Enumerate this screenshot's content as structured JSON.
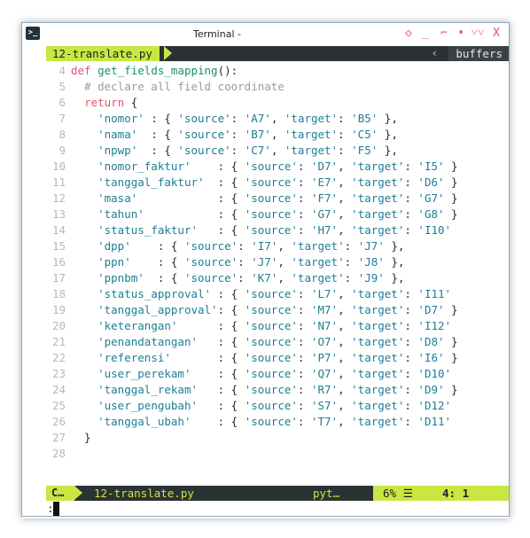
{
  "window": {
    "title": "Terminal -"
  },
  "controls": [
    "◇",
    "_",
    "⌐",
    "•",
    "˅˅",
    "X"
  ],
  "tabline": {
    "tab": "12-translate.py",
    "buffers": "buffers",
    "arrow": "‹"
  },
  "lines": [
    {
      "n": "4",
      "tokens": [
        [
          "kw",
          "def"
        ],
        [
          "pl",
          " "
        ],
        [
          "fn",
          "get_fields_mapping"
        ],
        [
          "pl",
          "():"
        ]
      ]
    },
    {
      "n": "5",
      "tokens": [
        [
          "cm",
          "  # declare all field coordinate"
        ]
      ]
    },
    {
      "n": "6",
      "tokens": [
        [
          "pl",
          "  "
        ],
        [
          "kw",
          "return"
        ],
        [
          "pl",
          " {"
        ]
      ]
    },
    {
      "n": "7",
      "tokens": [
        [
          "pl",
          "    "
        ],
        [
          "st",
          "'nomor'"
        ],
        [
          "pl",
          " : { "
        ],
        [
          "st",
          "'source'"
        ],
        [
          "pl",
          ": "
        ],
        [
          "st",
          "'A7'"
        ],
        [
          "pl",
          ", "
        ],
        [
          "st",
          "'target'"
        ],
        [
          "pl",
          ": "
        ],
        [
          "st",
          "'B5'"
        ],
        [
          "pl",
          " },"
        ]
      ]
    },
    {
      "n": "8",
      "tokens": [
        [
          "pl",
          "    "
        ],
        [
          "st",
          "'nama'"
        ],
        [
          "pl",
          "  : { "
        ],
        [
          "st",
          "'source'"
        ],
        [
          "pl",
          ": "
        ],
        [
          "st",
          "'B7'"
        ],
        [
          "pl",
          ", "
        ],
        [
          "st",
          "'target'"
        ],
        [
          "pl",
          ": "
        ],
        [
          "st",
          "'C5'"
        ],
        [
          "pl",
          " },"
        ]
      ]
    },
    {
      "n": "9",
      "tokens": [
        [
          "pl",
          "    "
        ],
        [
          "st",
          "'npwp'"
        ],
        [
          "pl",
          "  : { "
        ],
        [
          "st",
          "'source'"
        ],
        [
          "pl",
          ": "
        ],
        [
          "st",
          "'C7'"
        ],
        [
          "pl",
          ", "
        ],
        [
          "st",
          "'target'"
        ],
        [
          "pl",
          ": "
        ],
        [
          "st",
          "'F5'"
        ],
        [
          "pl",
          " },"
        ]
      ]
    },
    {
      "n": "10",
      "tokens": [
        [
          "pl",
          "    "
        ],
        [
          "st",
          "'nomor_faktur'"
        ],
        [
          "pl",
          "    : { "
        ],
        [
          "st",
          "'source'"
        ],
        [
          "pl",
          ": "
        ],
        [
          "st",
          "'D7'"
        ],
        [
          "pl",
          ", "
        ],
        [
          "st",
          "'target'"
        ],
        [
          "pl",
          ": "
        ],
        [
          "st",
          "'I5'"
        ],
        [
          "pl",
          " }"
        ]
      ]
    },
    {
      "n": "11",
      "tokens": [
        [
          "pl",
          "    "
        ],
        [
          "st",
          "'tanggal_faktur'"
        ],
        [
          "pl",
          "  : { "
        ],
        [
          "st",
          "'source'"
        ],
        [
          "pl",
          ": "
        ],
        [
          "st",
          "'E7'"
        ],
        [
          "pl",
          ", "
        ],
        [
          "st",
          "'target'"
        ],
        [
          "pl",
          ": "
        ],
        [
          "st",
          "'D6'"
        ],
        [
          "pl",
          " }"
        ]
      ]
    },
    {
      "n": "12",
      "tokens": [
        [
          "pl",
          "    "
        ],
        [
          "st",
          "'masa'"
        ],
        [
          "pl",
          "            : { "
        ],
        [
          "st",
          "'source'"
        ],
        [
          "pl",
          ": "
        ],
        [
          "st",
          "'F7'"
        ],
        [
          "pl",
          ", "
        ],
        [
          "st",
          "'target'"
        ],
        [
          "pl",
          ": "
        ],
        [
          "st",
          "'G7'"
        ],
        [
          "pl",
          " }"
        ]
      ]
    },
    {
      "n": "13",
      "tokens": [
        [
          "pl",
          "    "
        ],
        [
          "st",
          "'tahun'"
        ],
        [
          "pl",
          "           : { "
        ],
        [
          "st",
          "'source'"
        ],
        [
          "pl",
          ": "
        ],
        [
          "st",
          "'G7'"
        ],
        [
          "pl",
          ", "
        ],
        [
          "st",
          "'target'"
        ],
        [
          "pl",
          ": "
        ],
        [
          "st",
          "'G8'"
        ],
        [
          "pl",
          " }"
        ]
      ]
    },
    {
      "n": "14",
      "tokens": [
        [
          "pl",
          "    "
        ],
        [
          "st",
          "'status_faktur'"
        ],
        [
          "pl",
          "   : { "
        ],
        [
          "st",
          "'source'"
        ],
        [
          "pl",
          ": "
        ],
        [
          "st",
          "'H7'"
        ],
        [
          "pl",
          ", "
        ],
        [
          "st",
          "'target'"
        ],
        [
          "pl",
          ": "
        ],
        [
          "st",
          "'I10'"
        ]
      ]
    },
    {
      "n": "15",
      "tokens": [
        [
          "pl",
          "    "
        ],
        [
          "st",
          "'dpp'"
        ],
        [
          "pl",
          "    : { "
        ],
        [
          "st",
          "'source'"
        ],
        [
          "pl",
          ": "
        ],
        [
          "st",
          "'I7'"
        ],
        [
          "pl",
          ", "
        ],
        [
          "st",
          "'target'"
        ],
        [
          "pl",
          ": "
        ],
        [
          "st",
          "'J7'"
        ],
        [
          "pl",
          " },"
        ]
      ]
    },
    {
      "n": "16",
      "tokens": [
        [
          "pl",
          "    "
        ],
        [
          "st",
          "'ppn'"
        ],
        [
          "pl",
          "    : { "
        ],
        [
          "st",
          "'source'"
        ],
        [
          "pl",
          ": "
        ],
        [
          "st",
          "'J7'"
        ],
        [
          "pl",
          ", "
        ],
        [
          "st",
          "'target'"
        ],
        [
          "pl",
          ": "
        ],
        [
          "st",
          "'J8'"
        ],
        [
          "pl",
          " },"
        ]
      ]
    },
    {
      "n": "17",
      "tokens": [
        [
          "pl",
          "    "
        ],
        [
          "st",
          "'ppnbm'"
        ],
        [
          "pl",
          "  : { "
        ],
        [
          "st",
          "'source'"
        ],
        [
          "pl",
          ": "
        ],
        [
          "st",
          "'K7'"
        ],
        [
          "pl",
          ", "
        ],
        [
          "st",
          "'target'"
        ],
        [
          "pl",
          ": "
        ],
        [
          "st",
          "'J9'"
        ],
        [
          "pl",
          " },"
        ]
      ]
    },
    {
      "n": "18",
      "tokens": [
        [
          "pl",
          "    "
        ],
        [
          "st",
          "'status_approval'"
        ],
        [
          "pl",
          " : { "
        ],
        [
          "st",
          "'source'"
        ],
        [
          "pl",
          ": "
        ],
        [
          "st",
          "'L7'"
        ],
        [
          "pl",
          ", "
        ],
        [
          "st",
          "'target'"
        ],
        [
          "pl",
          ": "
        ],
        [
          "st",
          "'I11'"
        ]
      ]
    },
    {
      "n": "19",
      "tokens": [
        [
          "pl",
          "    "
        ],
        [
          "st",
          "'tanggal_approval'"
        ],
        [
          "pl",
          ": { "
        ],
        [
          "st",
          "'source'"
        ],
        [
          "pl",
          ": "
        ],
        [
          "st",
          "'M7'"
        ],
        [
          "pl",
          ", "
        ],
        [
          "st",
          "'target'"
        ],
        [
          "pl",
          ": "
        ],
        [
          "st",
          "'D7'"
        ],
        [
          "pl",
          " }"
        ]
      ]
    },
    {
      "n": "20",
      "tokens": [
        [
          "pl",
          "    "
        ],
        [
          "st",
          "'keterangan'"
        ],
        [
          "pl",
          "      : { "
        ],
        [
          "st",
          "'source'"
        ],
        [
          "pl",
          ": "
        ],
        [
          "st",
          "'N7'"
        ],
        [
          "pl",
          ", "
        ],
        [
          "st",
          "'target'"
        ],
        [
          "pl",
          ": "
        ],
        [
          "st",
          "'I12'"
        ]
      ]
    },
    {
      "n": "21",
      "tokens": [
        [
          "pl",
          "    "
        ],
        [
          "st",
          "'penandatangan'"
        ],
        [
          "pl",
          "   : { "
        ],
        [
          "st",
          "'source'"
        ],
        [
          "pl",
          ": "
        ],
        [
          "st",
          "'O7'"
        ],
        [
          "pl",
          ", "
        ],
        [
          "st",
          "'target'"
        ],
        [
          "pl",
          ": "
        ],
        [
          "st",
          "'D8'"
        ],
        [
          "pl",
          " }"
        ]
      ]
    },
    {
      "n": "22",
      "tokens": [
        [
          "pl",
          "    "
        ],
        [
          "st",
          "'referensi'"
        ],
        [
          "pl",
          "       : { "
        ],
        [
          "st",
          "'source'"
        ],
        [
          "pl",
          ": "
        ],
        [
          "st",
          "'P7'"
        ],
        [
          "pl",
          ", "
        ],
        [
          "st",
          "'target'"
        ],
        [
          "pl",
          ": "
        ],
        [
          "st",
          "'I6'"
        ],
        [
          "pl",
          " }"
        ]
      ]
    },
    {
      "n": "23",
      "tokens": [
        [
          "pl",
          "    "
        ],
        [
          "st",
          "'user_perekam'"
        ],
        [
          "pl",
          "    : { "
        ],
        [
          "st",
          "'source'"
        ],
        [
          "pl",
          ": "
        ],
        [
          "st",
          "'Q7'"
        ],
        [
          "pl",
          ", "
        ],
        [
          "st",
          "'target'"
        ],
        [
          "pl",
          ": "
        ],
        [
          "st",
          "'D10'"
        ]
      ]
    },
    {
      "n": "24",
      "tokens": [
        [
          "pl",
          "    "
        ],
        [
          "st",
          "'tanggal_rekam'"
        ],
        [
          "pl",
          "   : { "
        ],
        [
          "st",
          "'source'"
        ],
        [
          "pl",
          ": "
        ],
        [
          "st",
          "'R7'"
        ],
        [
          "pl",
          ", "
        ],
        [
          "st",
          "'target'"
        ],
        [
          "pl",
          ": "
        ],
        [
          "st",
          "'D9'"
        ],
        [
          "pl",
          " }"
        ]
      ]
    },
    {
      "n": "25",
      "tokens": [
        [
          "pl",
          "    "
        ],
        [
          "st",
          "'user_pengubah'"
        ],
        [
          "pl",
          "   : { "
        ],
        [
          "st",
          "'source'"
        ],
        [
          "pl",
          ": "
        ],
        [
          "st",
          "'S7'"
        ],
        [
          "pl",
          ", "
        ],
        [
          "st",
          "'target'"
        ],
        [
          "pl",
          ": "
        ],
        [
          "st",
          "'D12'"
        ]
      ]
    },
    {
      "n": "26",
      "tokens": [
        [
          "pl",
          "    "
        ],
        [
          "st",
          "'tanggal_ubah'"
        ],
        [
          "pl",
          "    : { "
        ],
        [
          "st",
          "'source'"
        ],
        [
          "pl",
          ": "
        ],
        [
          "st",
          "'T7'"
        ],
        [
          "pl",
          ", "
        ],
        [
          "st",
          "'target'"
        ],
        [
          "pl",
          ": "
        ],
        [
          "st",
          "'D11'"
        ]
      ]
    },
    {
      "n": "27",
      "tokens": [
        [
          "pl",
          "  }"
        ]
      ]
    },
    {
      "n": "28",
      "tokens": []
    }
  ],
  "statusline": {
    "mode": "C…",
    "file": "12-translate.py",
    "filetype": "pyt…",
    "percent": "6% ☰",
    "position": "4:  1"
  },
  "cmdline": {
    "text": ":"
  }
}
